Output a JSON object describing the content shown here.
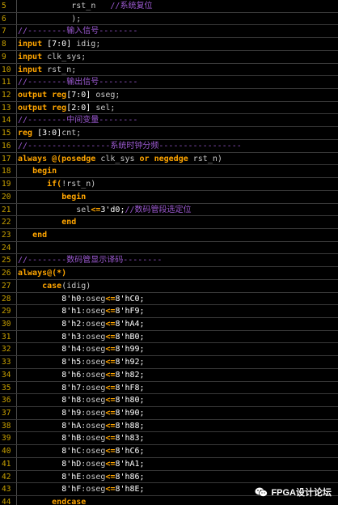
{
  "lines": [
    {
      "no": "5",
      "indent": 11,
      "segments": [
        {
          "t": "rst_n   ",
          "c": "nm"
        },
        {
          "t": "//系统复位",
          "c": "cm"
        }
      ]
    },
    {
      "no": "6",
      "indent": 11,
      "segments": [
        {
          "t": ");",
          "c": "nm"
        }
      ]
    },
    {
      "no": "7",
      "indent": 0,
      "segments": [
        {
          "t": "//--------输入信号--------",
          "c": "cm"
        }
      ]
    },
    {
      "no": "8",
      "indent": 0,
      "segments": [
        {
          "t": "input ",
          "c": "kw"
        },
        {
          "t": "[7:0] ",
          "c": "lit"
        },
        {
          "t": "idig;",
          "c": "nm"
        }
      ]
    },
    {
      "no": "9",
      "indent": 0,
      "segments": [
        {
          "t": "input ",
          "c": "kw"
        },
        {
          "t": "clk_sys;",
          "c": "nm"
        }
      ]
    },
    {
      "no": "10",
      "indent": 0,
      "segments": [
        {
          "t": "input ",
          "c": "kw"
        },
        {
          "t": "rst_n;",
          "c": "nm"
        }
      ]
    },
    {
      "no": "11",
      "indent": 0,
      "segments": [
        {
          "t": "//--------输出信号--------",
          "c": "cm"
        }
      ]
    },
    {
      "no": "12",
      "indent": 0,
      "segments": [
        {
          "t": "output reg",
          "c": "kw"
        },
        {
          "t": "[7:0] ",
          "c": "lit"
        },
        {
          "t": "oseg;",
          "c": "nm"
        }
      ]
    },
    {
      "no": "13",
      "indent": 0,
      "segments": [
        {
          "t": "output reg",
          "c": "kw"
        },
        {
          "t": "[2:0] ",
          "c": "lit"
        },
        {
          "t": "sel;",
          "c": "nm"
        }
      ]
    },
    {
      "no": "14",
      "indent": 0,
      "segments": [
        {
          "t": "//--------中间变量--------",
          "c": "cm"
        }
      ]
    },
    {
      "no": "15",
      "indent": 0,
      "segments": [
        {
          "t": "reg ",
          "c": "kw"
        },
        {
          "t": "[3:0]",
          "c": "lit"
        },
        {
          "t": "cnt;",
          "c": "nm"
        }
      ]
    },
    {
      "no": "16",
      "indent": 0,
      "segments": [
        {
          "t": "//-----------------系统时钟分频-----------------",
          "c": "cm"
        }
      ]
    },
    {
      "no": "17",
      "indent": 0,
      "segments": [
        {
          "t": "always @(posedge ",
          "c": "kw"
        },
        {
          "t": "clk_sys ",
          "c": "nm"
        },
        {
          "t": "or negedge ",
          "c": "kw"
        },
        {
          "t": "rst_n)",
          "c": "nm"
        }
      ]
    },
    {
      "no": "18",
      "indent": 3,
      "segments": [
        {
          "t": "begin",
          "c": "kw"
        }
      ]
    },
    {
      "no": "19",
      "indent": 6,
      "segments": [
        {
          "t": "if(",
          "c": "kw"
        },
        {
          "t": "!rst_n)",
          "c": "nm"
        }
      ]
    },
    {
      "no": "20",
      "indent": 9,
      "segments": [
        {
          "t": "begin",
          "c": "kw"
        }
      ]
    },
    {
      "no": "21",
      "indent": 12,
      "segments": [
        {
          "t": "sel",
          "c": "nm"
        },
        {
          "t": "<=",
          "c": "kw"
        },
        {
          "t": "3'd0;",
          "c": "lit"
        },
        {
          "t": "//数码管段选定位",
          "c": "cm"
        }
      ]
    },
    {
      "no": "22",
      "indent": 9,
      "segments": [
        {
          "t": "end",
          "c": "kw"
        }
      ]
    },
    {
      "no": "23",
      "indent": 3,
      "segments": [
        {
          "t": "end",
          "c": "kw"
        }
      ]
    },
    {
      "no": "24",
      "indent": 0,
      "segments": []
    },
    {
      "no": "25",
      "indent": 0,
      "segments": [
        {
          "t": "//--------数码管显示译码--------",
          "c": "cm"
        }
      ]
    },
    {
      "no": "26",
      "indent": 0,
      "segments": [
        {
          "t": "always@(*)",
          "c": "kw"
        }
      ]
    },
    {
      "no": "27",
      "indent": 5,
      "segments": [
        {
          "t": "case",
          "c": "kw"
        },
        {
          "t": "(idig)",
          "c": "nm"
        }
      ]
    },
    {
      "no": "28",
      "indent": 9,
      "segments": [
        {
          "t": "8'h0",
          "c": "lit"
        },
        {
          "t": ":oseg",
          "c": "nm"
        },
        {
          "t": "<=",
          "c": "kw"
        },
        {
          "t": "8'hC0;",
          "c": "lit"
        }
      ]
    },
    {
      "no": "29",
      "indent": 9,
      "segments": [
        {
          "t": "8'h1",
          "c": "lit"
        },
        {
          "t": ":oseg",
          "c": "nm"
        },
        {
          "t": "<=",
          "c": "kw"
        },
        {
          "t": "8'hF9;",
          "c": "lit"
        }
      ]
    },
    {
      "no": "30",
      "indent": 9,
      "segments": [
        {
          "t": "8'h2",
          "c": "lit"
        },
        {
          "t": ":oseg",
          "c": "nm"
        },
        {
          "t": "<=",
          "c": "kw"
        },
        {
          "t": "8'hA4;",
          "c": "lit"
        }
      ]
    },
    {
      "no": "31",
      "indent": 9,
      "segments": [
        {
          "t": "8'h3",
          "c": "lit"
        },
        {
          "t": ":oseg",
          "c": "nm"
        },
        {
          "t": "<=",
          "c": "kw"
        },
        {
          "t": "8'hB0;",
          "c": "lit"
        }
      ]
    },
    {
      "no": "32",
      "indent": 9,
      "segments": [
        {
          "t": "8'h4",
          "c": "lit"
        },
        {
          "t": ":oseg",
          "c": "nm"
        },
        {
          "t": "<=",
          "c": "kw"
        },
        {
          "t": "8'h99;",
          "c": "lit"
        }
      ]
    },
    {
      "no": "33",
      "indent": 9,
      "segments": [
        {
          "t": "8'h5",
          "c": "lit"
        },
        {
          "t": ":oseg",
          "c": "nm"
        },
        {
          "t": "<=",
          "c": "kw"
        },
        {
          "t": "8'h92;",
          "c": "lit"
        }
      ]
    },
    {
      "no": "34",
      "indent": 9,
      "segments": [
        {
          "t": "8'h6",
          "c": "lit"
        },
        {
          "t": ":oseg",
          "c": "nm"
        },
        {
          "t": "<=",
          "c": "kw"
        },
        {
          "t": "8'h82;",
          "c": "lit"
        }
      ]
    },
    {
      "no": "35",
      "indent": 9,
      "segments": [
        {
          "t": "8'h7",
          "c": "lit"
        },
        {
          "t": ":oseg",
          "c": "nm"
        },
        {
          "t": "<=",
          "c": "kw"
        },
        {
          "t": "8'hF8;",
          "c": "lit"
        }
      ]
    },
    {
      "no": "36",
      "indent": 9,
      "segments": [
        {
          "t": "8'h8",
          "c": "lit"
        },
        {
          "t": ":oseg",
          "c": "nm"
        },
        {
          "t": "<=",
          "c": "kw"
        },
        {
          "t": "8'h80;",
          "c": "lit"
        }
      ]
    },
    {
      "no": "37",
      "indent": 9,
      "segments": [
        {
          "t": "8'h9",
          "c": "lit"
        },
        {
          "t": ":oseg",
          "c": "nm"
        },
        {
          "t": "<=",
          "c": "kw"
        },
        {
          "t": "8'h90;",
          "c": "lit"
        }
      ]
    },
    {
      "no": "38",
      "indent": 9,
      "segments": [
        {
          "t": "8'hA",
          "c": "lit"
        },
        {
          "t": ":oseg",
          "c": "nm"
        },
        {
          "t": "<=",
          "c": "kw"
        },
        {
          "t": "8'h88;",
          "c": "lit"
        }
      ]
    },
    {
      "no": "39",
      "indent": 9,
      "segments": [
        {
          "t": "8'hB",
          "c": "lit"
        },
        {
          "t": ":oseg",
          "c": "nm"
        },
        {
          "t": "<=",
          "c": "kw"
        },
        {
          "t": "8'h83;",
          "c": "lit"
        }
      ]
    },
    {
      "no": "40",
      "indent": 9,
      "segments": [
        {
          "t": "8'hC",
          "c": "lit"
        },
        {
          "t": ":oseg",
          "c": "nm"
        },
        {
          "t": "<=",
          "c": "kw"
        },
        {
          "t": "8'hC6;",
          "c": "lit"
        }
      ]
    },
    {
      "no": "41",
      "indent": 9,
      "segments": [
        {
          "t": "8'hD",
          "c": "lit"
        },
        {
          "t": ":oseg",
          "c": "nm"
        },
        {
          "t": "<=",
          "c": "kw"
        },
        {
          "t": "8'hA1;",
          "c": "lit"
        }
      ]
    },
    {
      "no": "42",
      "indent": 9,
      "segments": [
        {
          "t": "8'hE",
          "c": "lit"
        },
        {
          "t": ":oseg",
          "c": "nm"
        },
        {
          "t": "<=",
          "c": "kw"
        },
        {
          "t": "8'h86;",
          "c": "lit"
        }
      ]
    },
    {
      "no": "43",
      "indent": 9,
      "segments": [
        {
          "t": "8'hF",
          "c": "lit"
        },
        {
          "t": ":oseg",
          "c": "nm"
        },
        {
          "t": "<=",
          "c": "kw"
        },
        {
          "t": "8'h8E;",
          "c": "lit"
        }
      ]
    },
    {
      "no": "44",
      "indent": 7,
      "segments": [
        {
          "t": "endcase",
          "c": "kw"
        }
      ]
    }
  ],
  "watermark": {
    "text": "FPGA设计论坛",
    "icon": "wechat-icon"
  },
  "colors": {
    "keyword": "#ffa500",
    "comment": "#9b59d0",
    "gutter": "#c8a000",
    "background": "#000000"
  }
}
